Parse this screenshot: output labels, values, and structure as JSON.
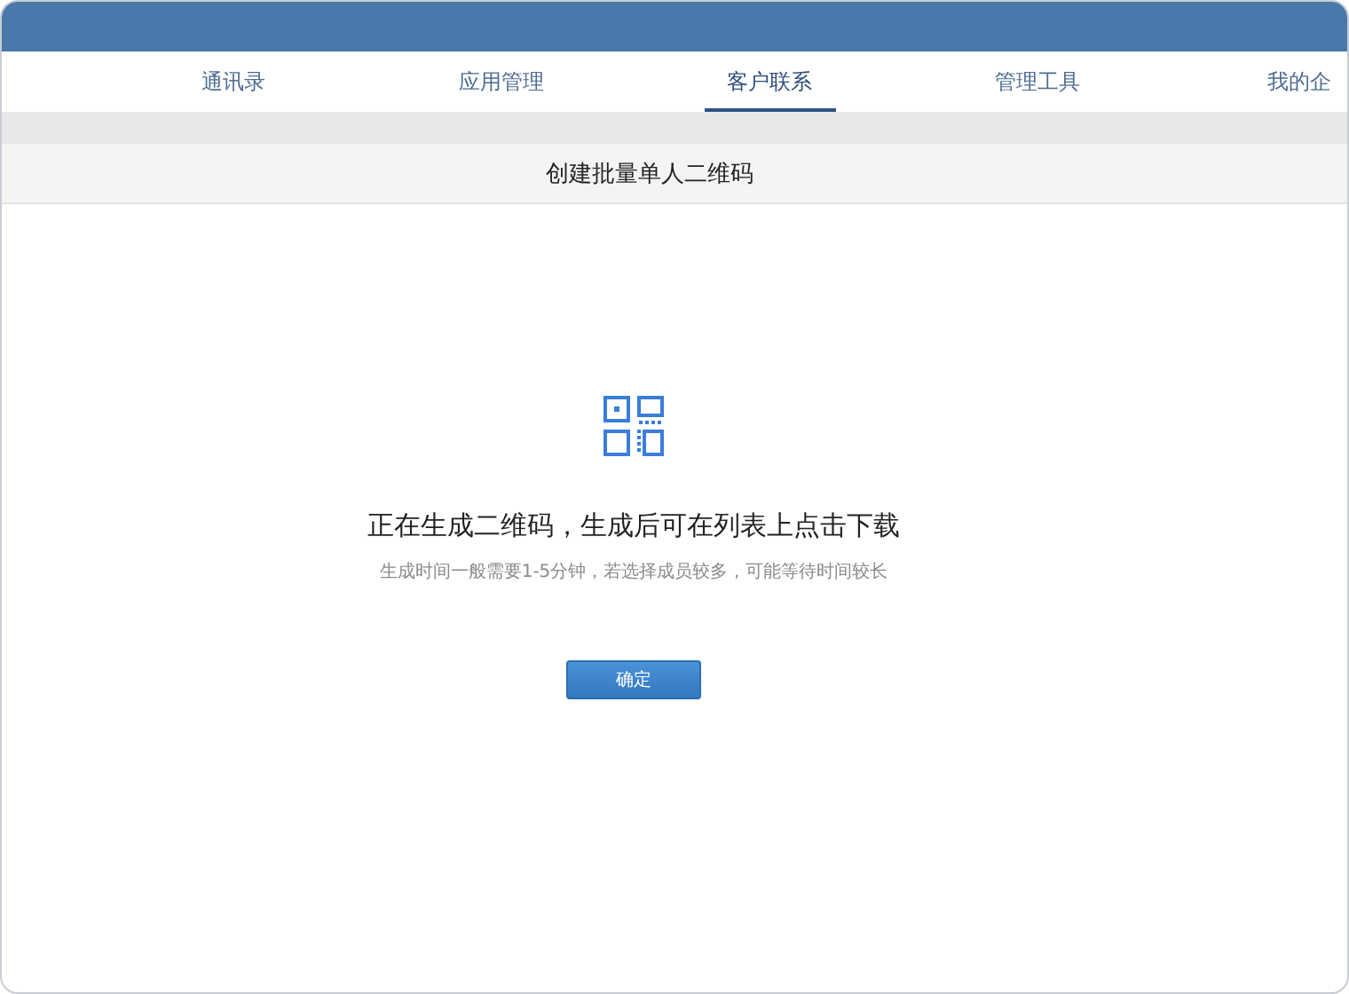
{
  "tabs": [
    {
      "label": "通讯录",
      "selected": false
    },
    {
      "label": "应用管理",
      "selected": false
    },
    {
      "label": "客户联系",
      "selected": true
    },
    {
      "label": "管理工具",
      "selected": false
    },
    {
      "label": "我的企",
      "selected": false
    }
  ],
  "page_title": "创建批量单人二维码",
  "message": {
    "heading": "正在生成二维码，生成后可在列表上点击下载",
    "note": "生成时间一般需要1-5分钟，若选择成员较多，可能等待时间较长"
  },
  "confirm_button": "确定"
}
